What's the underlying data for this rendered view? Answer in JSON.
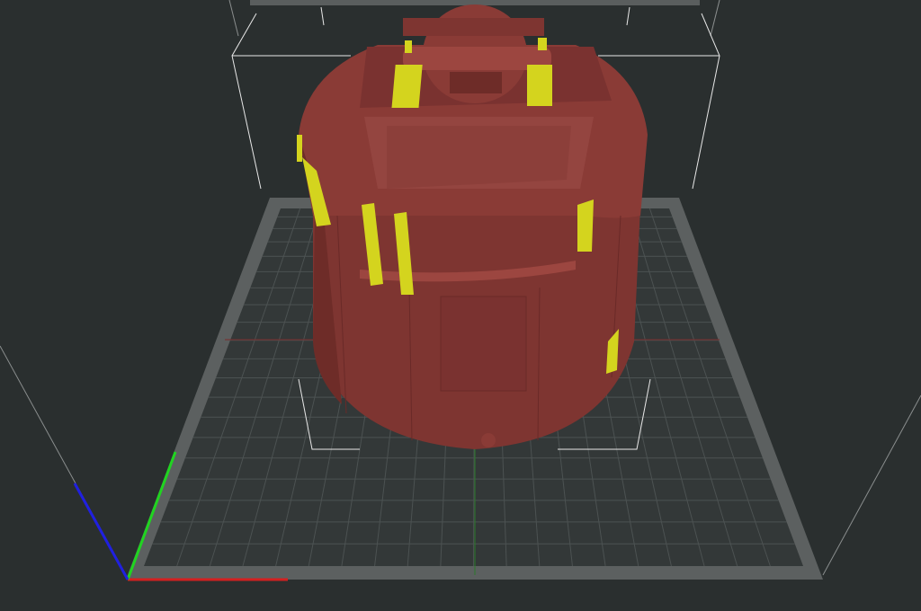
{
  "viewport": {
    "background_color": "#2a2f2f",
    "bed_border_color": "#5c6060",
    "bed_fill_color": "#333838",
    "grid_color": "#4c5252",
    "grid_divisions": 20,
    "model_color": "#8a3b36",
    "model_shade_color": "#6e2c28",
    "model_highlight_color": "#9c4640",
    "support_color": "#d4d41e",
    "axis_x_color": "#d42020",
    "axis_y_color": "#20d420",
    "axis_z_color": "#2020e0",
    "bounding_box_color": "#e8e8e8"
  }
}
